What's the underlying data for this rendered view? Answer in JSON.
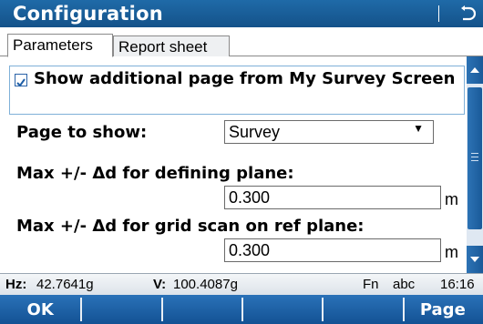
{
  "window": {
    "title": "Configuration",
    "back_icon": "back-arrow-icon"
  },
  "tabs": [
    {
      "label": "Parameters",
      "active": true
    },
    {
      "label": "Report sheet",
      "active": false
    }
  ],
  "form": {
    "show_additional": {
      "label": "Show additional page from My Survey Screen",
      "checked": true
    },
    "page_to_show": {
      "label": "Page to show:",
      "value": "Survey"
    },
    "max_defining_plane": {
      "label": "Max +/- Δd for defining plane:",
      "value": "0.300",
      "unit": "m"
    },
    "max_grid_scan": {
      "label": "Max +/- Δd for grid scan on ref plane:",
      "value": "0.300",
      "unit": "m"
    }
  },
  "status": {
    "hz_label": "Hz:",
    "hz_value": "42.7641g",
    "v_label": "V:",
    "v_value": "100.4087g",
    "fn": "Fn",
    "input_mode": "abc",
    "time": "16:16"
  },
  "softkeys": [
    "OK",
    "",
    "",
    "",
    "",
    "Page"
  ]
}
